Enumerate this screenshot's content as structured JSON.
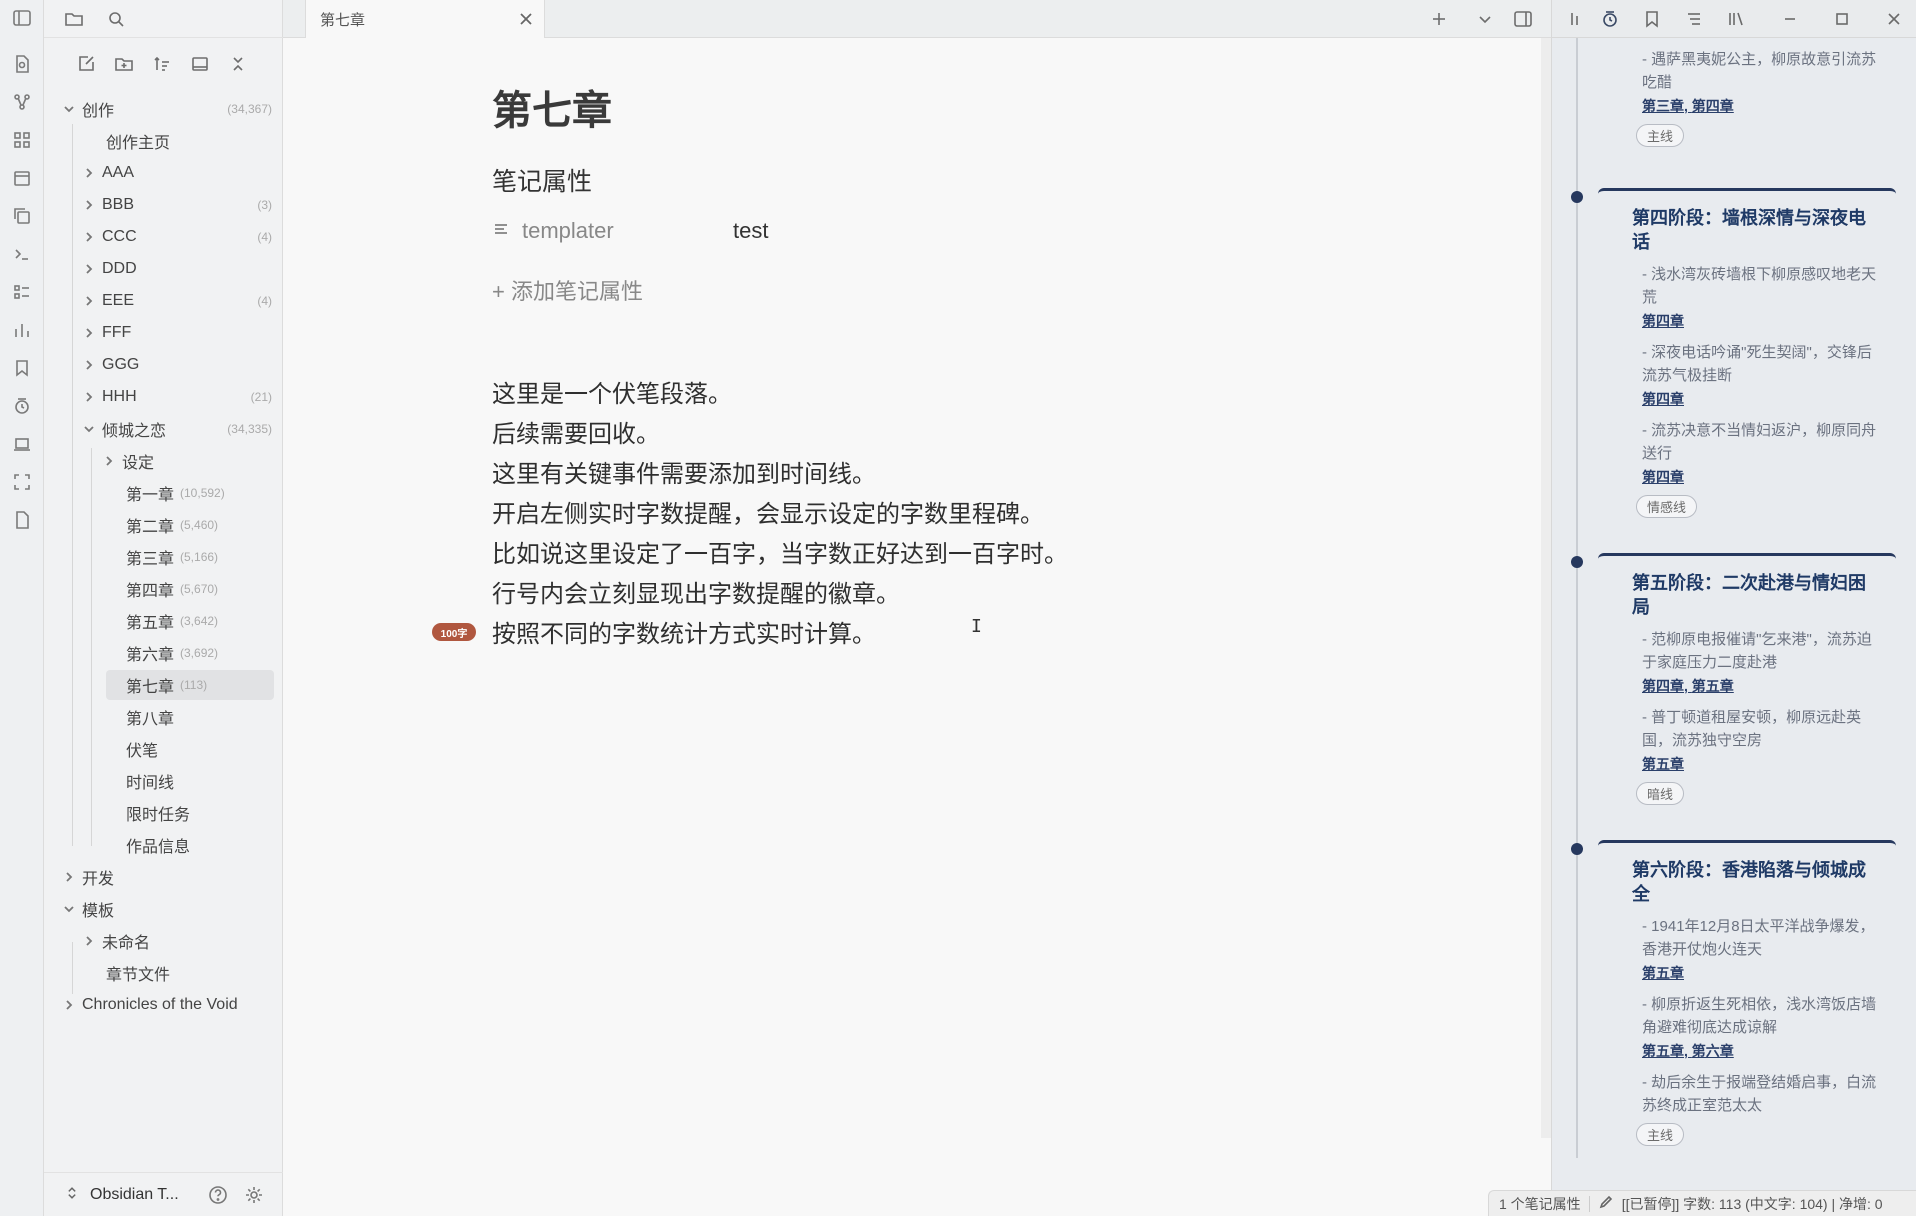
{
  "tab": {
    "title": "第七章"
  },
  "sidebar": {
    "tree": [
      {
        "label": "创作",
        "count": "(34,367)"
      },
      {
        "label": "创作主页",
        "count": ""
      },
      {
        "label": "AAA",
        "count": ""
      },
      {
        "label": "BBB",
        "count": "(3)"
      },
      {
        "label": "CCC",
        "count": "(4)"
      },
      {
        "label": "DDD",
        "count": ""
      },
      {
        "label": "EEE",
        "count": "(4)"
      },
      {
        "label": "FFF",
        "count": ""
      },
      {
        "label": "GGG",
        "count": ""
      },
      {
        "label": "HHH",
        "count": "(21)"
      },
      {
        "label": "倾城之恋",
        "count": "(34,335)"
      },
      {
        "label": "设定",
        "count": ""
      },
      {
        "label": "第一章",
        "count": "(10,592)"
      },
      {
        "label": "第二章",
        "count": "(5,460)"
      },
      {
        "label": "第三章",
        "count": "(5,166)"
      },
      {
        "label": "第四章",
        "count": "(5,670)"
      },
      {
        "label": "第五章",
        "count": "(3,642)"
      },
      {
        "label": "第六章",
        "count": "(3,692)"
      },
      {
        "label": "第七章",
        "count": "(113)"
      },
      {
        "label": "第八章",
        "count": ""
      },
      {
        "label": "伏笔",
        "count": ""
      },
      {
        "label": "时间线",
        "count": ""
      },
      {
        "label": "限时任务",
        "count": ""
      },
      {
        "label": "作品信息",
        "count": ""
      },
      {
        "label": "开发",
        "count": ""
      },
      {
        "label": "模板",
        "count": ""
      },
      {
        "label": "未命名",
        "count": ""
      },
      {
        "label": "章节文件",
        "count": ""
      },
      {
        "label": "Chronicles of the Void",
        "count": ""
      }
    ],
    "vault_name": "Obsidian T..."
  },
  "editor": {
    "title": "第七章",
    "properties_heading": "笔记属性",
    "property": {
      "key": "templater",
      "value": "test"
    },
    "add_property": "+ 添加笔记属性",
    "lines": [
      "这里是一个伏笔段落。",
      "后续需要回收。",
      "这里有关键事件需要添加到时间线。",
      "开启左侧实时字数提醒，会显示设定的字数里程碑。",
      "比如说这里设定了一百字，当字数正好达到一百字时。",
      "行号内会立刻显现出字数提醒的徽章。",
      "按照不同的字数统计方式实时计算。"
    ],
    "milestone_badge": "100字",
    "accent": "#b0573f"
  },
  "timeline": {
    "accent": "#26385e",
    "top_card": {
      "events": [
        {
          "text": "- 遇萨黑夷妮公主，柳原故意引流苏吃醋",
          "refs": [
            "第三章",
            "第四章"
          ]
        }
      ],
      "tag": "主线"
    },
    "cards": [
      {
        "title": "第四阶段：墙根深情与深夜电话",
        "events": [
          {
            "text": "- 浅水湾灰砖墙根下柳原感叹地老天荒",
            "refs": [
              "第四章"
            ]
          },
          {
            "text": "- 深夜电话吟诵\"死生契阔\"，交锋后流苏气极挂断",
            "refs": [
              "第四章"
            ]
          },
          {
            "text": "- 流苏决意不当情妇返沪，柳原同舟送行",
            "refs": [
              "第四章"
            ]
          }
        ],
        "tag": "情感线"
      },
      {
        "title": "第五阶段：二次赴港与情妇困局",
        "events": [
          {
            "text": "- 范柳原电报催请\"乞来港\"，流苏迫于家庭压力二度赴港",
            "refs": [
              "第四章",
              "第五章"
            ]
          },
          {
            "text": "- 普丁顿道租屋安顿，柳原远赴英国，流苏独守空房",
            "refs": [
              "第五章"
            ]
          }
        ],
        "tag": "暗线"
      },
      {
        "title": "第六阶段：香港陷落与倾城成全",
        "events": [
          {
            "text": "- 1941年12月8日太平洋战争爆发，香港开仗炮火连天",
            "refs": [
              "第五章"
            ]
          },
          {
            "text": "- 柳原折返生死相依，浅水湾饭店墙角避难彻底达成谅解",
            "refs": [
              "第五章",
              "第六章"
            ]
          },
          {
            "text": "- 劫后余生于报端登结婚启事，白流苏终成正室范太太",
            "refs": []
          }
        ],
        "tag": "主线"
      }
    ]
  },
  "statusbar": {
    "props": "1 个笔记属性",
    "counts": "[[已暂停]] 字数: 113 (中文字: 104) | 净增: 0"
  }
}
